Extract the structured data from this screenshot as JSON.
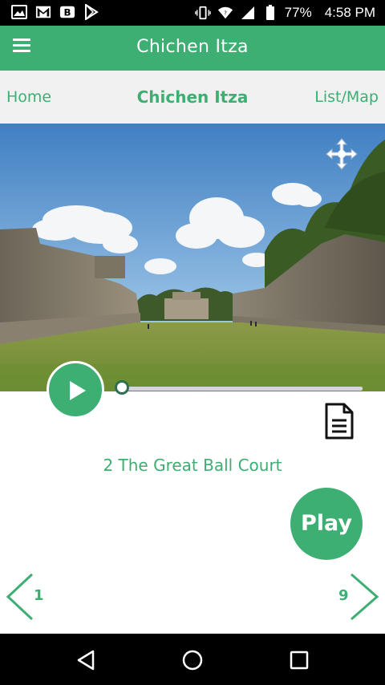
{
  "status_bar": {
    "left_icons": [
      "photo-icon",
      "gmail-icon",
      "b-app-icon",
      "play-store-icon"
    ],
    "battery_percent": "77%",
    "time": "4:58 PM"
  },
  "app_bar": {
    "title": "Chichen Itza"
  },
  "nav_row": {
    "home": "Home",
    "center": "Chichen Itza",
    "list_map": "List/Map"
  },
  "player": {
    "progress": 0.0
  },
  "stop": {
    "title": "2 The Great Ball Court"
  },
  "play_button": "Play",
  "pager": {
    "prev_number": "1",
    "next_number": "9"
  },
  "colors": {
    "accent": "#3daf73",
    "statusbar": "#000000"
  }
}
